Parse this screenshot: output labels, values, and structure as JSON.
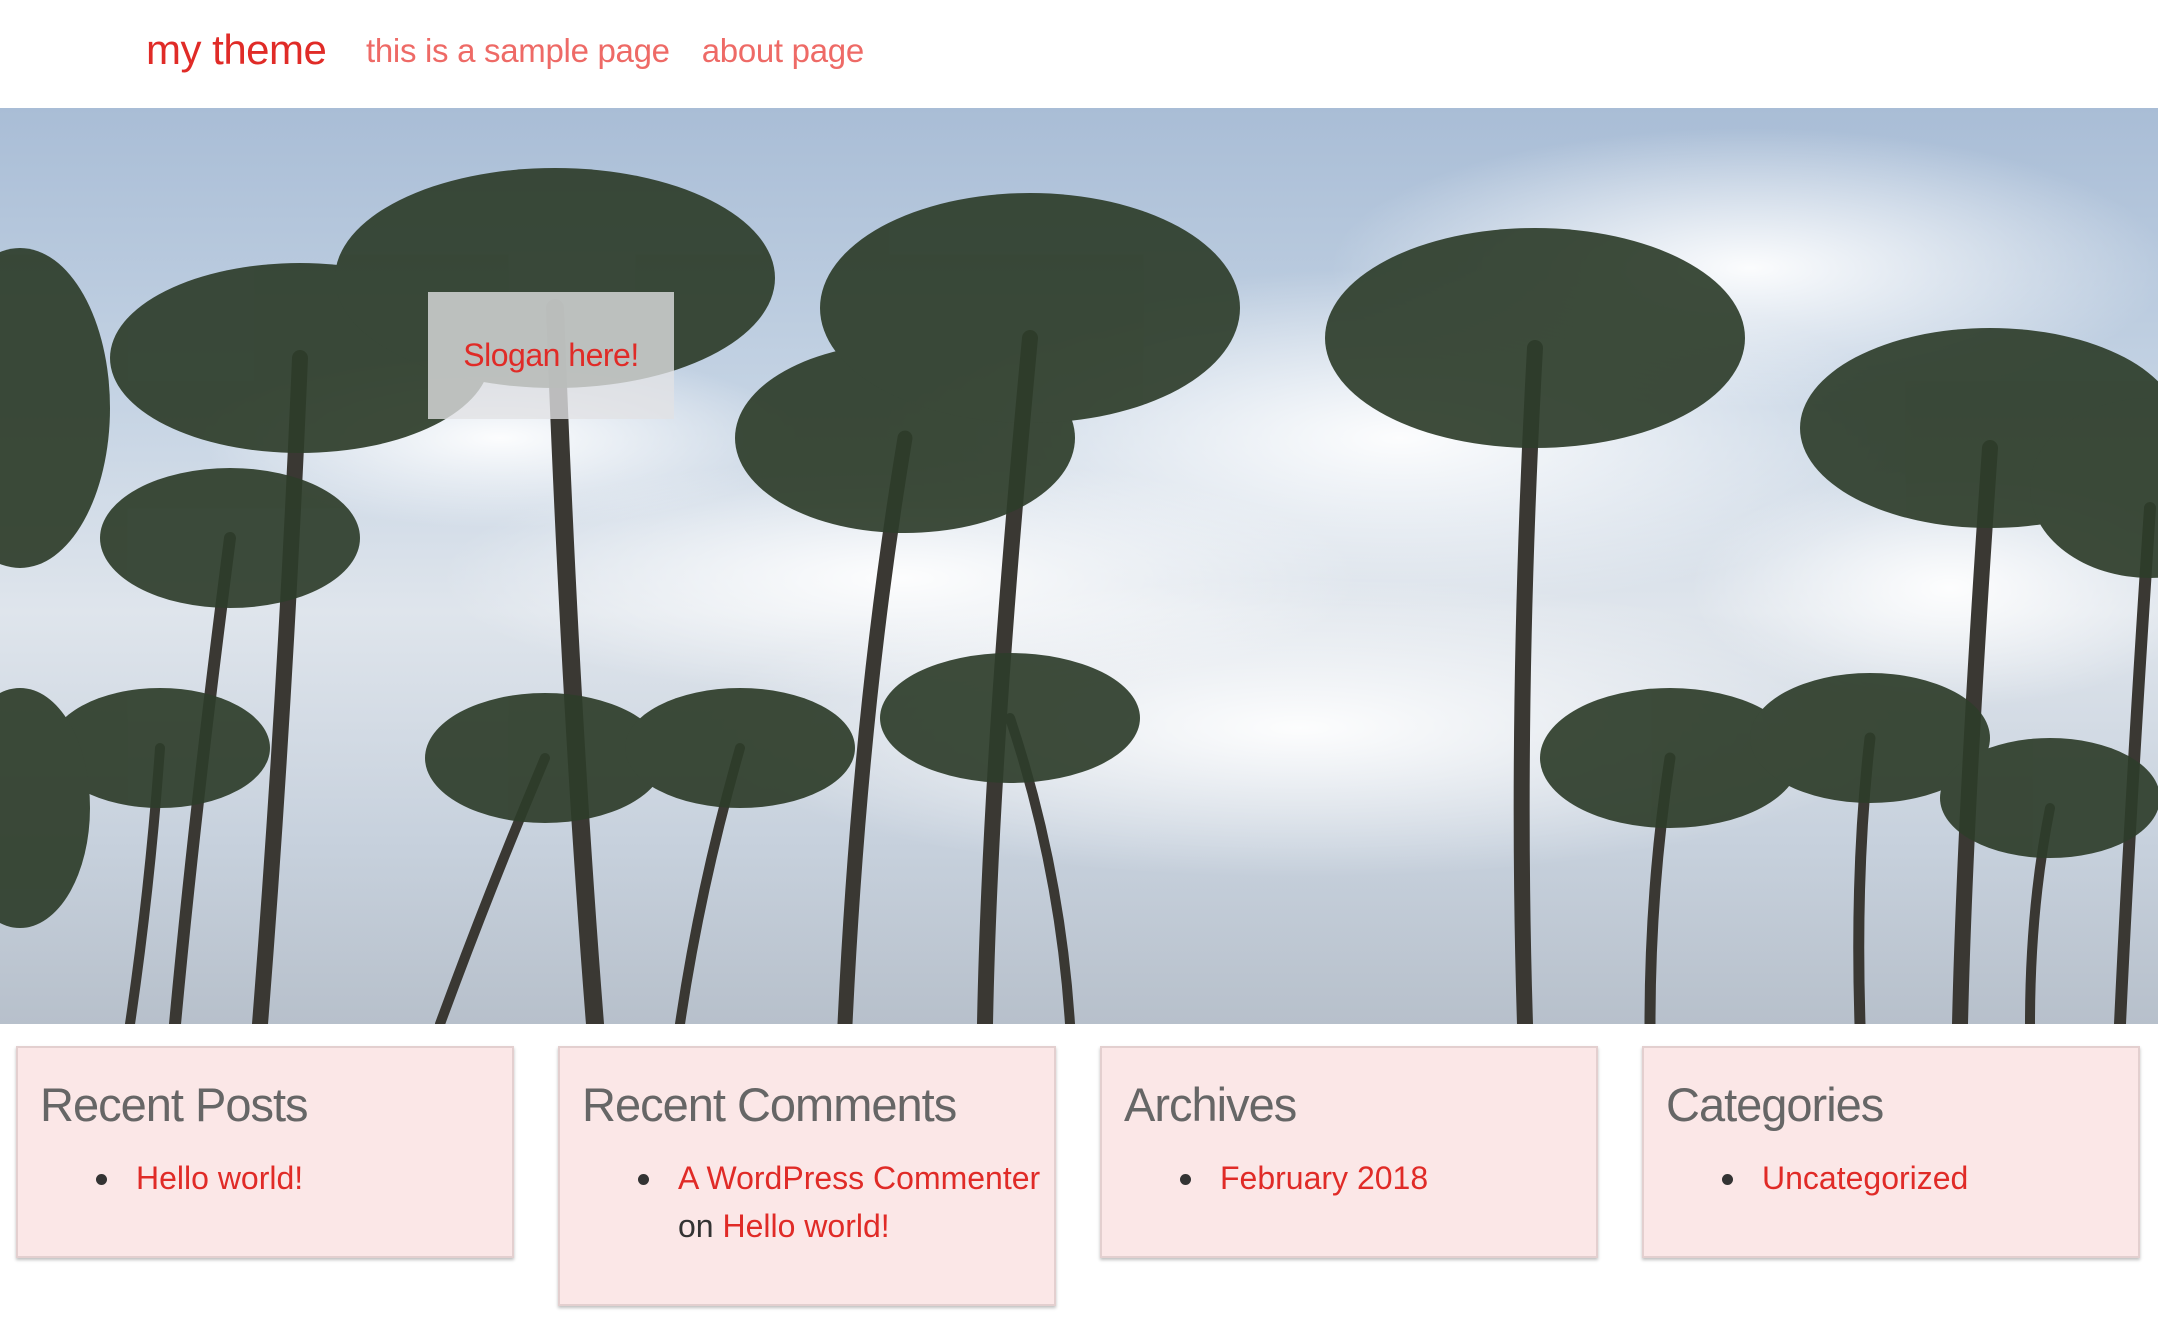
{
  "header": {
    "site_title": "my theme",
    "nav": [
      {
        "label": "this is a sample page"
      },
      {
        "label": "about page"
      }
    ]
  },
  "hero": {
    "slogan": "Slogan here!"
  },
  "widgets": {
    "recent_posts": {
      "title": "Recent Posts",
      "items": [
        {
          "link": "Hello world!"
        }
      ]
    },
    "recent_comments": {
      "title": "Recent Comments",
      "items": [
        {
          "author": "A WordPress Commenter",
          "on": "on",
          "post": "Hello world!"
        }
      ]
    },
    "archives": {
      "title": "Archives",
      "items": [
        {
          "link": "February 2018"
        }
      ]
    },
    "categories": {
      "title": "Categories",
      "items": [
        {
          "link": "Uncategorized"
        }
      ]
    }
  },
  "colors": {
    "accent": "#e02b27",
    "nav_link": "#ee6a66",
    "widget_bg": "#fbe7e7",
    "widget_title": "#666666"
  }
}
